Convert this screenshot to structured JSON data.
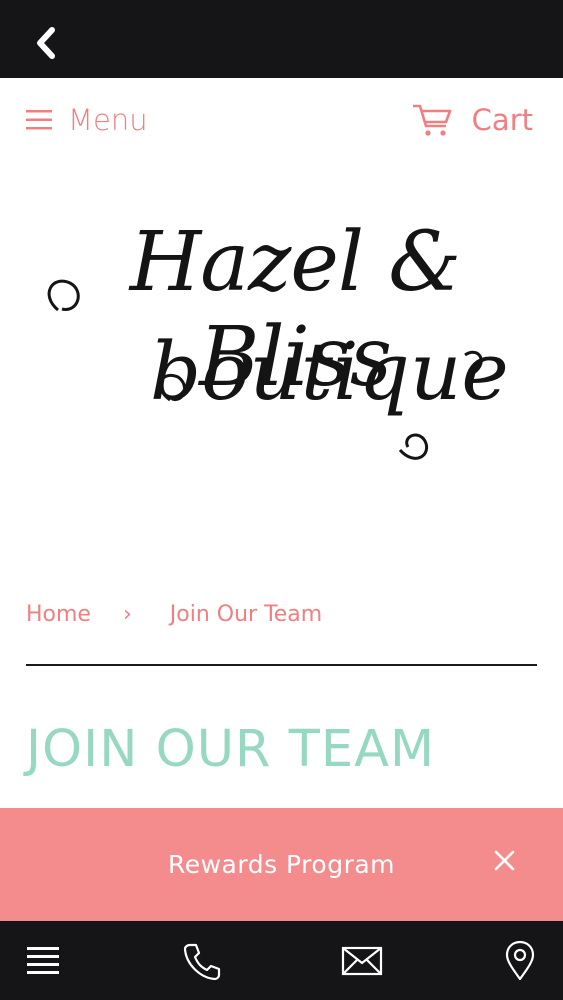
{
  "header": {
    "back_icon": "chevron-left-icon"
  },
  "nav": {
    "menu_label": "Menu",
    "cart_label": "Cart",
    "menu_icon": "hamburger-icon",
    "cart_icon": "shopping-cart-icon",
    "accent_color": "#f07f82"
  },
  "logo": {
    "line1": "Hazel & Bliss",
    "line2": "boutique"
  },
  "breadcrumb": {
    "home": "Home",
    "separator": "›",
    "current": "Join Our Team"
  },
  "page": {
    "title": "JOIN OUR TEAM",
    "title_color": "#97d9c0"
  },
  "banner": {
    "text": "Rewards Program",
    "close_icon": "close-icon",
    "background": "#f48b8d"
  },
  "tabbar": {
    "items": [
      {
        "icon": "list-icon"
      },
      {
        "icon": "phone-icon"
      },
      {
        "icon": "mail-icon"
      },
      {
        "icon": "map-pin-icon"
      }
    ]
  }
}
